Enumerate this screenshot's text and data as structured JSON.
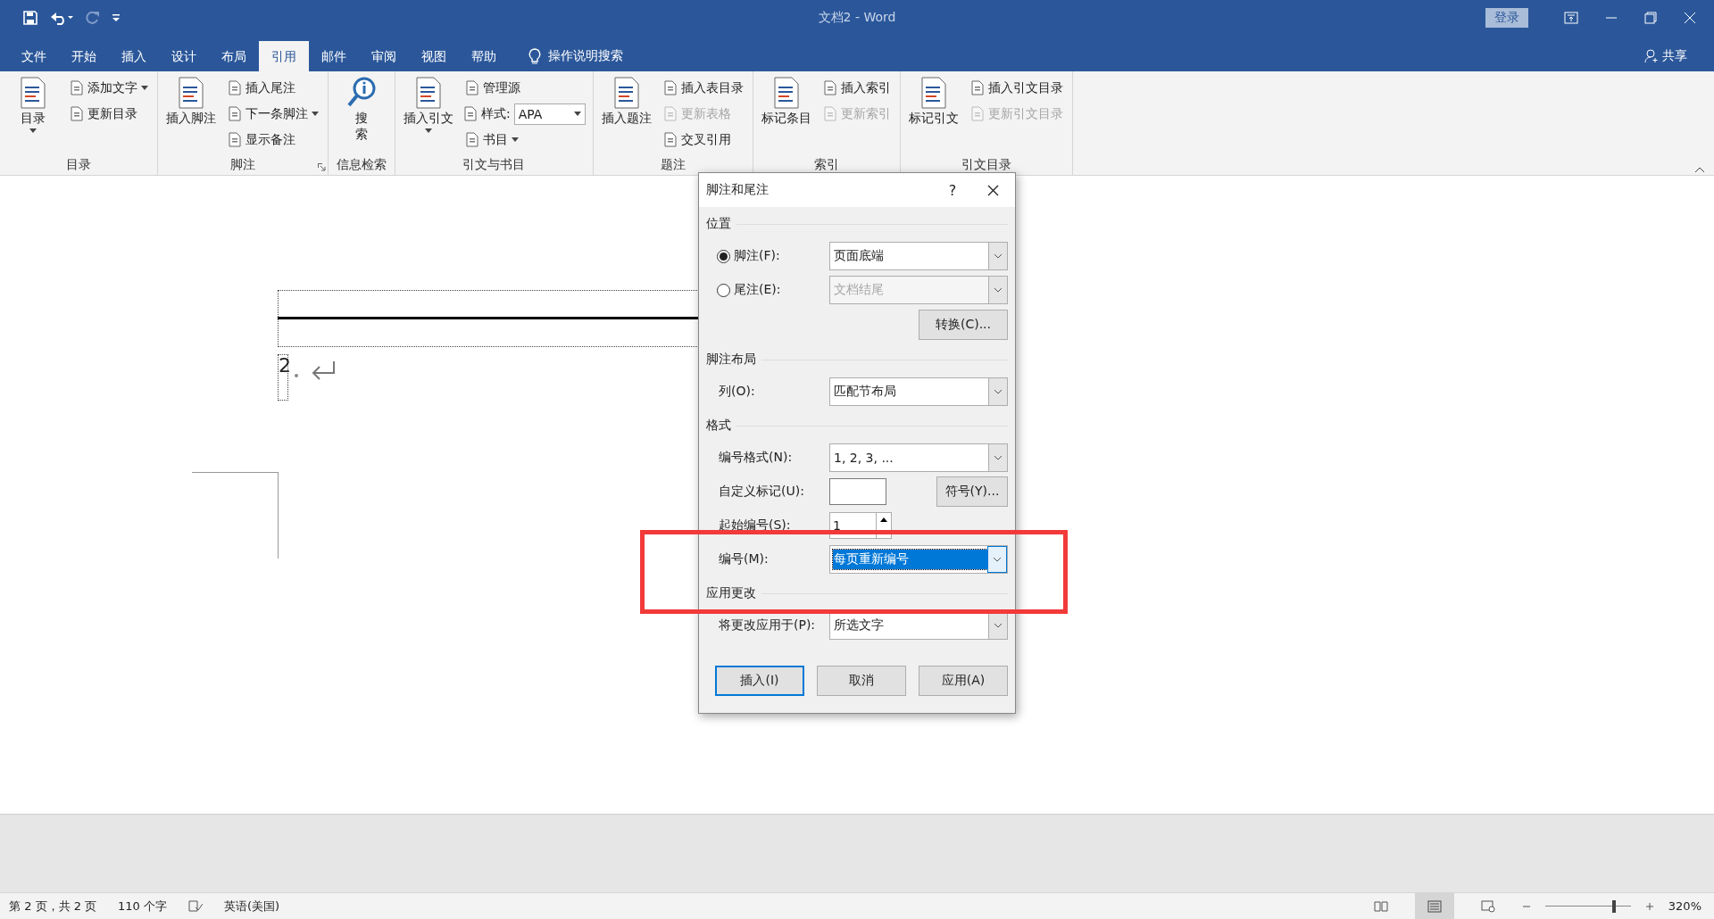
{
  "window": {
    "title": "文档2 - Word",
    "sign_in": "登录",
    "share": "共享"
  },
  "tabs": [
    {
      "label": "文件",
      "selected": false
    },
    {
      "label": "开始",
      "selected": false
    },
    {
      "label": "插入",
      "selected": false
    },
    {
      "label": "设计",
      "selected": false
    },
    {
      "label": "布局",
      "selected": false
    },
    {
      "label": "引用",
      "selected": true
    },
    {
      "label": "邮件",
      "selected": false
    },
    {
      "label": "审阅",
      "selected": false
    },
    {
      "label": "视图",
      "selected": false
    },
    {
      "label": "帮助",
      "selected": false
    }
  ],
  "tell_me": "操作说明搜索",
  "ribbon": [
    {
      "label": "目录",
      "launcher": false,
      "items": [
        {
          "kind": "large",
          "label": "目录",
          "dropdown": true,
          "disabled": false
        },
        {
          "kind": "small",
          "label": "添加文字",
          "dropdown": true,
          "disabled": false
        },
        {
          "kind": "small",
          "label": "更新目录",
          "dropdown": false,
          "disabled": false
        }
      ]
    },
    {
      "label": "脚注",
      "launcher": true,
      "items": [
        {
          "kind": "large",
          "label": "插入脚注",
          "dropdown": false,
          "disabled": false
        },
        {
          "kind": "small",
          "label": "插入尾注",
          "dropdown": false,
          "disabled": false
        },
        {
          "kind": "small",
          "label": "下一条脚注",
          "dropdown": true,
          "disabled": false
        },
        {
          "kind": "small",
          "label": "显示备注",
          "dropdown": false,
          "disabled": false
        }
      ]
    },
    {
      "label": "信息检索",
      "launcher": false,
      "items": [
        {
          "kind": "search",
          "label": "搜索",
          "dropdown": false,
          "disabled": false
        }
      ]
    },
    {
      "label": "引文与书目",
      "launcher": false,
      "items": [
        {
          "kind": "large",
          "label": "插入引文",
          "dropdown": true,
          "disabled": false
        },
        {
          "kind": "small",
          "label": "管理源",
          "dropdown": false,
          "disabled": false
        },
        {
          "kind": "combo",
          "label": "样式:",
          "value": "APA",
          "dropdown": true,
          "disabled": false
        },
        {
          "kind": "small",
          "label": "书目",
          "dropdown": true,
          "disabled": false
        }
      ]
    },
    {
      "label": "题注",
      "launcher": false,
      "items": [
        {
          "kind": "large",
          "label": "插入题注",
          "dropdown": false,
          "disabled": false
        },
        {
          "kind": "small",
          "label": "插入表目录",
          "dropdown": false,
          "disabled": false
        },
        {
          "kind": "small",
          "label": "更新表格",
          "dropdown": false,
          "disabled": true
        },
        {
          "kind": "small",
          "label": "交叉引用",
          "dropdown": false,
          "disabled": false
        }
      ]
    },
    {
      "label": "索引",
      "launcher": false,
      "items": [
        {
          "kind": "large",
          "label": "标记条目",
          "dropdown": false,
          "disabled": false
        },
        {
          "kind": "small",
          "label": "插入索引",
          "dropdown": false,
          "disabled": false
        },
        {
          "kind": "small",
          "label": "更新索引",
          "dropdown": false,
          "disabled": true
        }
      ]
    },
    {
      "label": "引文目录",
      "launcher": false,
      "items": [
        {
          "kind": "large",
          "label": "标记引文",
          "dropdown": false,
          "disabled": false
        },
        {
          "kind": "small",
          "label": "插入引文目录",
          "dropdown": false,
          "disabled": false
        },
        {
          "kind": "small",
          "label": "更新引文目录",
          "dropdown": false,
          "disabled": true
        }
      ]
    }
  ],
  "document": {
    "footnote_number": "2"
  },
  "dialog": {
    "title": "脚注和尾注",
    "help": "?",
    "sections": [
      {
        "title": "位置",
        "rows": [
          {
            "kind": "radio",
            "label": "脚注(F):",
            "selected": true,
            "value": "页面底端",
            "disabled": false
          },
          {
            "kind": "radio",
            "label": "尾注(E):",
            "selected": false,
            "value": "文档结尾",
            "disabled": true
          },
          {
            "kind": "button",
            "button": "转换(C)..."
          }
        ]
      },
      {
        "title": "脚注布局",
        "rows": [
          {
            "kind": "select",
            "label": "列(O):",
            "value": "匹配节布局",
            "focused": false
          }
        ]
      },
      {
        "title": "格式",
        "rows": [
          {
            "kind": "select",
            "label": "编号格式(N):",
            "value": "1, 2, 3, ...",
            "focused": false
          },
          {
            "kind": "input",
            "label": "自定义标记(U):",
            "button": "符号(Y)..."
          },
          {
            "kind": "spin",
            "label": "起始编号(S):",
            "value": "1"
          },
          {
            "kind": "select",
            "label": "编号(M):",
            "value": "每页重新编号",
            "focused": true
          }
        ]
      },
      {
        "title": "应用更改",
        "rows": [
          {
            "kind": "select",
            "label": "将更改应用于(P):",
            "value": "所选文字",
            "focused": false
          }
        ]
      }
    ],
    "buttons": [
      {
        "label": "插入(I)",
        "default": true
      },
      {
        "label": "取消",
        "default": false
      },
      {
        "label": "应用(A)",
        "default": false
      }
    ]
  },
  "status_bar": {
    "page": "第 2 页，共 2 页",
    "words": "110 个字",
    "language": "英语(美国)",
    "zoom": "320%",
    "zoom_slider": {
      "level": 0.78
    }
  }
}
